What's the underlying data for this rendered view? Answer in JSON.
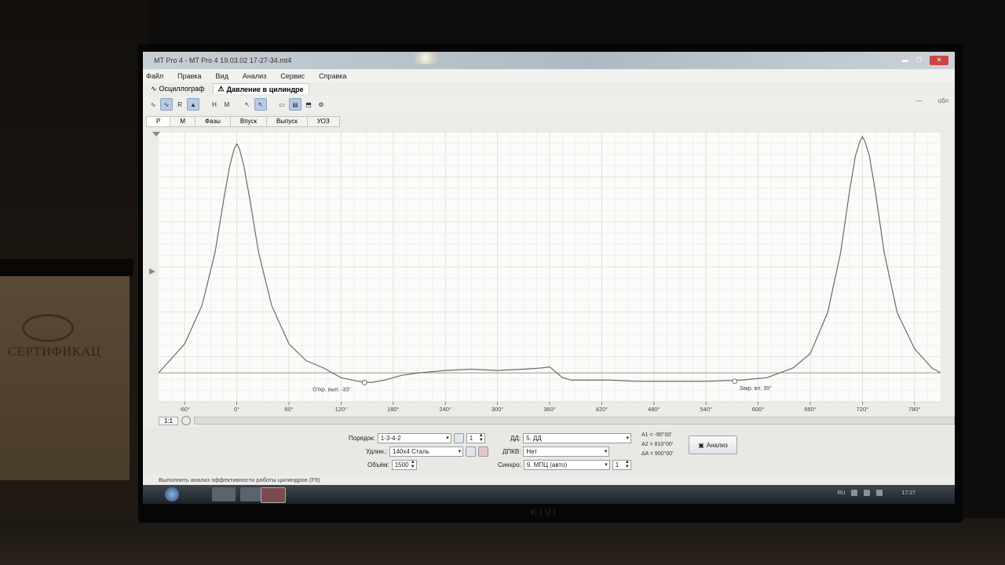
{
  "window": {
    "title": "MT Pro 4 - MT Pro 4 19.03.02 17-27-34.mt4"
  },
  "menu": [
    "Файл",
    "Правка",
    "Вид",
    "Анализ",
    "Сервис",
    "Справка"
  ],
  "tabs": {
    "oscillograph": "Осциллограф",
    "cylinder_pressure": "Давление в цилиндре"
  },
  "toolbar_right_label": "обл",
  "subtabs": [
    "P",
    "M",
    "Фазы",
    "Впуск",
    "Выпуск",
    "УОЗ"
  ],
  "chart_data": {
    "type": "line",
    "x_ticks": [
      "-60°",
      "0°",
      "60°",
      "120°",
      "180°",
      "240°",
      "300°",
      "360°",
      "420°",
      "480°",
      "540°",
      "600°",
      "660°",
      "720°",
      "780°"
    ],
    "xlim": [
      -90,
      810
    ],
    "ylim": [
      -0.12,
      1.0
    ],
    "grid": true,
    "series": [
      {
        "x": [
          -90,
          -60,
          -40,
          -25,
          -15,
          -8,
          -3,
          0,
          3,
          8,
          15,
          25,
          40,
          60,
          80,
          100,
          120,
          140,
          155,
          170,
          190,
          210,
          240,
          270,
          300,
          330,
          350,
          360,
          365,
          375,
          385,
          400,
          430,
          460,
          500,
          540,
          580,
          610,
          640,
          660,
          680,
          695,
          705,
          712,
          717,
          720,
          723,
          728,
          735,
          745,
          760,
          780,
          800,
          810
        ],
        "y": [
          0.0,
          0.12,
          0.28,
          0.5,
          0.72,
          0.86,
          0.93,
          0.95,
          0.93,
          0.86,
          0.72,
          0.5,
          0.28,
          0.12,
          0.05,
          0.02,
          -0.02,
          -0.035,
          -0.04,
          -0.03,
          -0.01,
          0.0,
          0.01,
          0.015,
          0.01,
          0.015,
          0.02,
          0.025,
          0.01,
          -0.02,
          -0.03,
          -0.03,
          -0.03,
          -0.035,
          -0.035,
          -0.035,
          -0.03,
          -0.02,
          0.02,
          0.08,
          0.25,
          0.5,
          0.75,
          0.9,
          0.96,
          0.98,
          0.96,
          0.9,
          0.75,
          0.5,
          0.25,
          0.1,
          0.02,
          0.0
        ]
      }
    ],
    "baseline": 0.0,
    "markers": [
      {
        "x": 147,
        "y": -0.04,
        "label": "Откр. вып: -33°"
      },
      {
        "x": 573,
        "y": -0.035,
        "label": "Закр. вп: 39°"
      }
    ]
  },
  "zoom": "1:1",
  "bottom": {
    "order_label": "Порядок:",
    "order_value": "1-3-4-2",
    "order_spin": "1",
    "extension_label": "Удлин.:",
    "extension_value": "140x4 Сталь",
    "volume_label": "Объём:",
    "volume_value": "1500",
    "dd_label": "ДД:",
    "dd_value": "5. ДД",
    "dpkv_label": "ДПКВ:",
    "dpkv_value": "Нет",
    "sync_label": "Синхро:",
    "sync_value": "9. МПЦ (авто)",
    "sync_spin": "1",
    "a1": "A1 = -90°00'",
    "a2": "A2 = 810°00'",
    "da": "ΔA = 900°00'",
    "analyze_label": "Анализ"
  },
  "status_text": "Выполнить анализ эффективности работы цилиндров (F9)",
  "taskbar": {
    "lang": "RU",
    "time": "17:27"
  },
  "monitor_brand": "KIVI",
  "poster_text": "СЕРТИФИКАЦ"
}
